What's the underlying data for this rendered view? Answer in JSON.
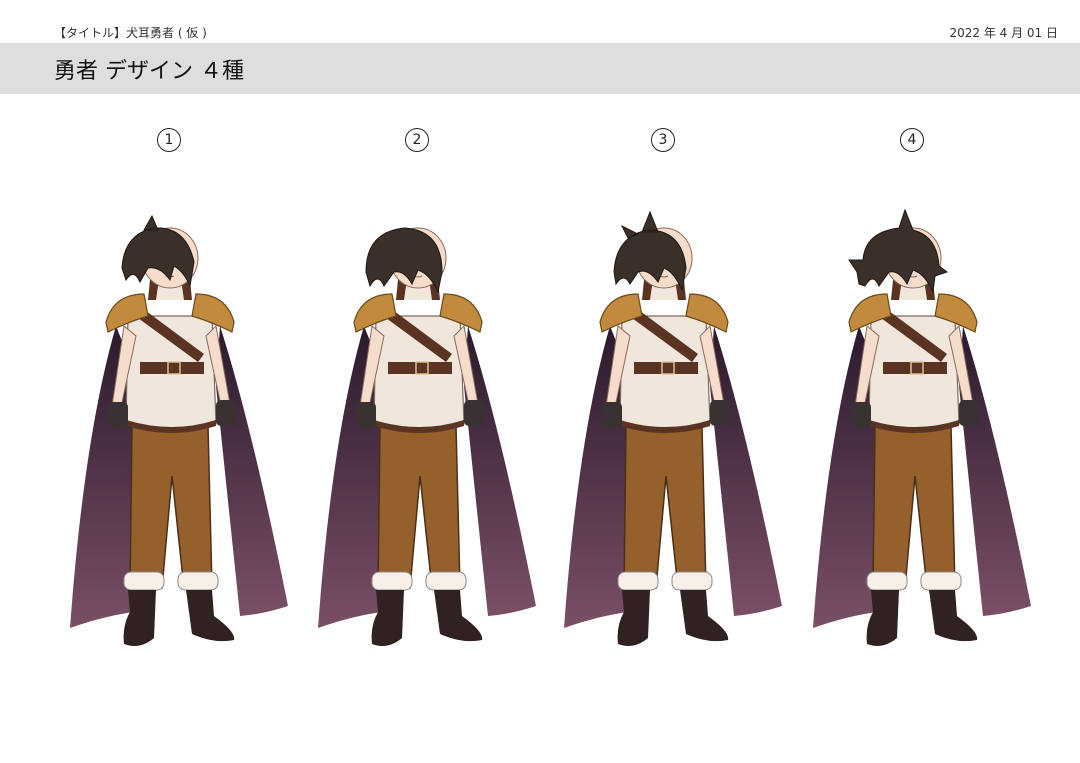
{
  "header": {
    "doc_title": "【タイトル】犬耳勇者 ( 仮 )",
    "date": "2022 年 4 月 01 日"
  },
  "banner": {
    "title": "勇者 デザイン ４種"
  },
  "designs": [
    {
      "number": "1",
      "hair": "straight"
    },
    {
      "number": "2",
      "hair": "rounded"
    },
    {
      "number": "3",
      "hair": "spiky"
    },
    {
      "number": "4",
      "hair": "wild"
    }
  ],
  "colors": {
    "banner": "#dedede",
    "cape_top": "#2a1a2e",
    "cape_bottom": "#7a4f66",
    "shirt": "#f1e6db",
    "pants": "#95602c",
    "armor": "#c28a3c",
    "belt": "#5a3322",
    "boots": "#2f2221",
    "hair": "#3a3029",
    "skin": "#f6dccb"
  }
}
